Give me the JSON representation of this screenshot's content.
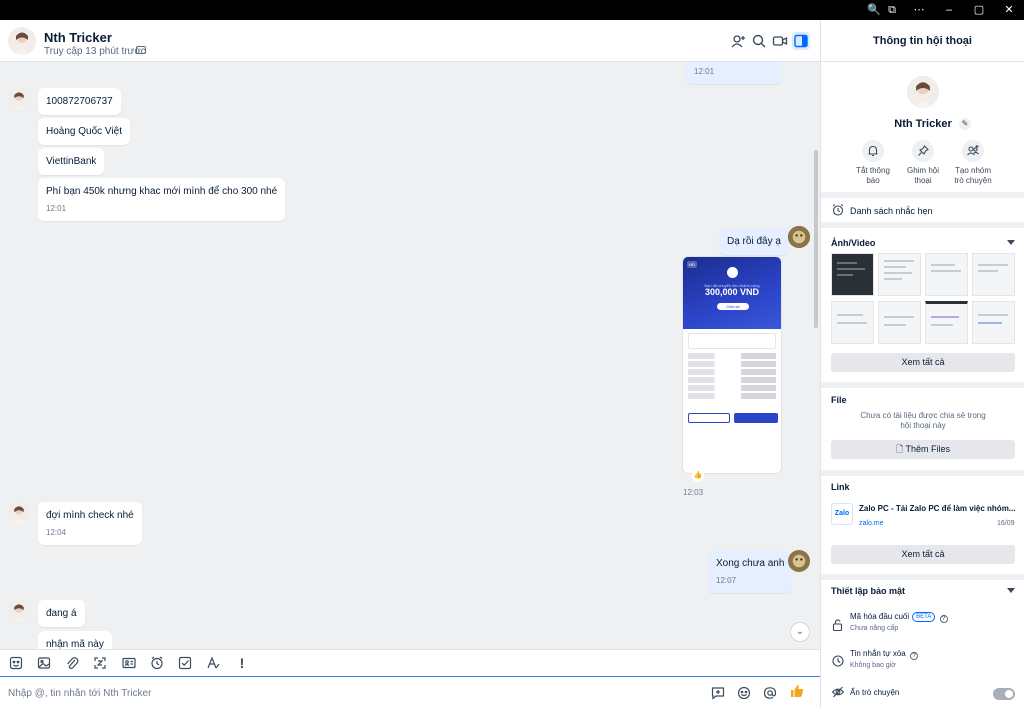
{
  "window": {
    "controls": [
      "🔍",
      "⧉",
      "⋯",
      "–",
      "▢",
      "✕"
    ]
  },
  "header": {
    "name": "Nth Tricker",
    "status": "Truy cập 13 phút trước"
  },
  "messages": {
    "top_time": "12:01",
    "m1": "100872706737",
    "m2": "Hoàng Quốc Việt",
    "m3": "ViettinBank",
    "m4": "Phí bạn 450k nhưng khac mới mình để cho 300 nhé",
    "m4_time": "12:01",
    "m5": "Dạ rồi đây ạ",
    "image_time": "12:03",
    "m6": "đợi mình check nhé",
    "m6_time": "12:04",
    "m7": "Xong chưa anh",
    "m7_time": "12:07",
    "m8": "đang á",
    "m9": "nhận mã này"
  },
  "receipt": {
    "badge": "HD",
    "caption": "Bạn đã chuyển tiền thành công",
    "amount": "300,000 VND",
    "pill": "Chia sẻ"
  },
  "composer": {
    "placeholder": "Nhập @, tin nhắn tới Nth Tricker"
  },
  "panel": {
    "title": "Thông tin hội thoại",
    "name": "Nth Tricker",
    "actions": [
      {
        "label1": "Tắt thông",
        "label2": "báo"
      },
      {
        "label1": "Ghim hội",
        "label2": "thoại"
      },
      {
        "label1": "Tạo nhóm",
        "label2": "trò chuyện"
      }
    ],
    "reminders": "Danh sách nhắc hẹn",
    "media_title": "Ảnh/Video",
    "view_all": "Xem tất cả",
    "file_title": "File",
    "file_empty1": "Chưa có tài liệu được chia sẻ trong",
    "file_empty2": "hội thoại này",
    "add_files": "Thêm Files",
    "link_title": "Link",
    "link_logo": "Zalo",
    "link_text": "Zalo PC - Tải Zalo PC để làm việc nhóm...",
    "link_domain": "zalo.me",
    "link_date": "16/09",
    "link_view_all": "Xem tất cả",
    "security_title": "Thiết lập bảo mật",
    "e2e": "Mã hóa đầu cuối",
    "beta": "BETA",
    "e2e_sub": "Chưa nâng cấp",
    "auto_delete": "Tin nhắn tự xóa",
    "auto_delete_sub": "Không bao giờ",
    "hide_chat": "Ẩn trò chuyện"
  }
}
